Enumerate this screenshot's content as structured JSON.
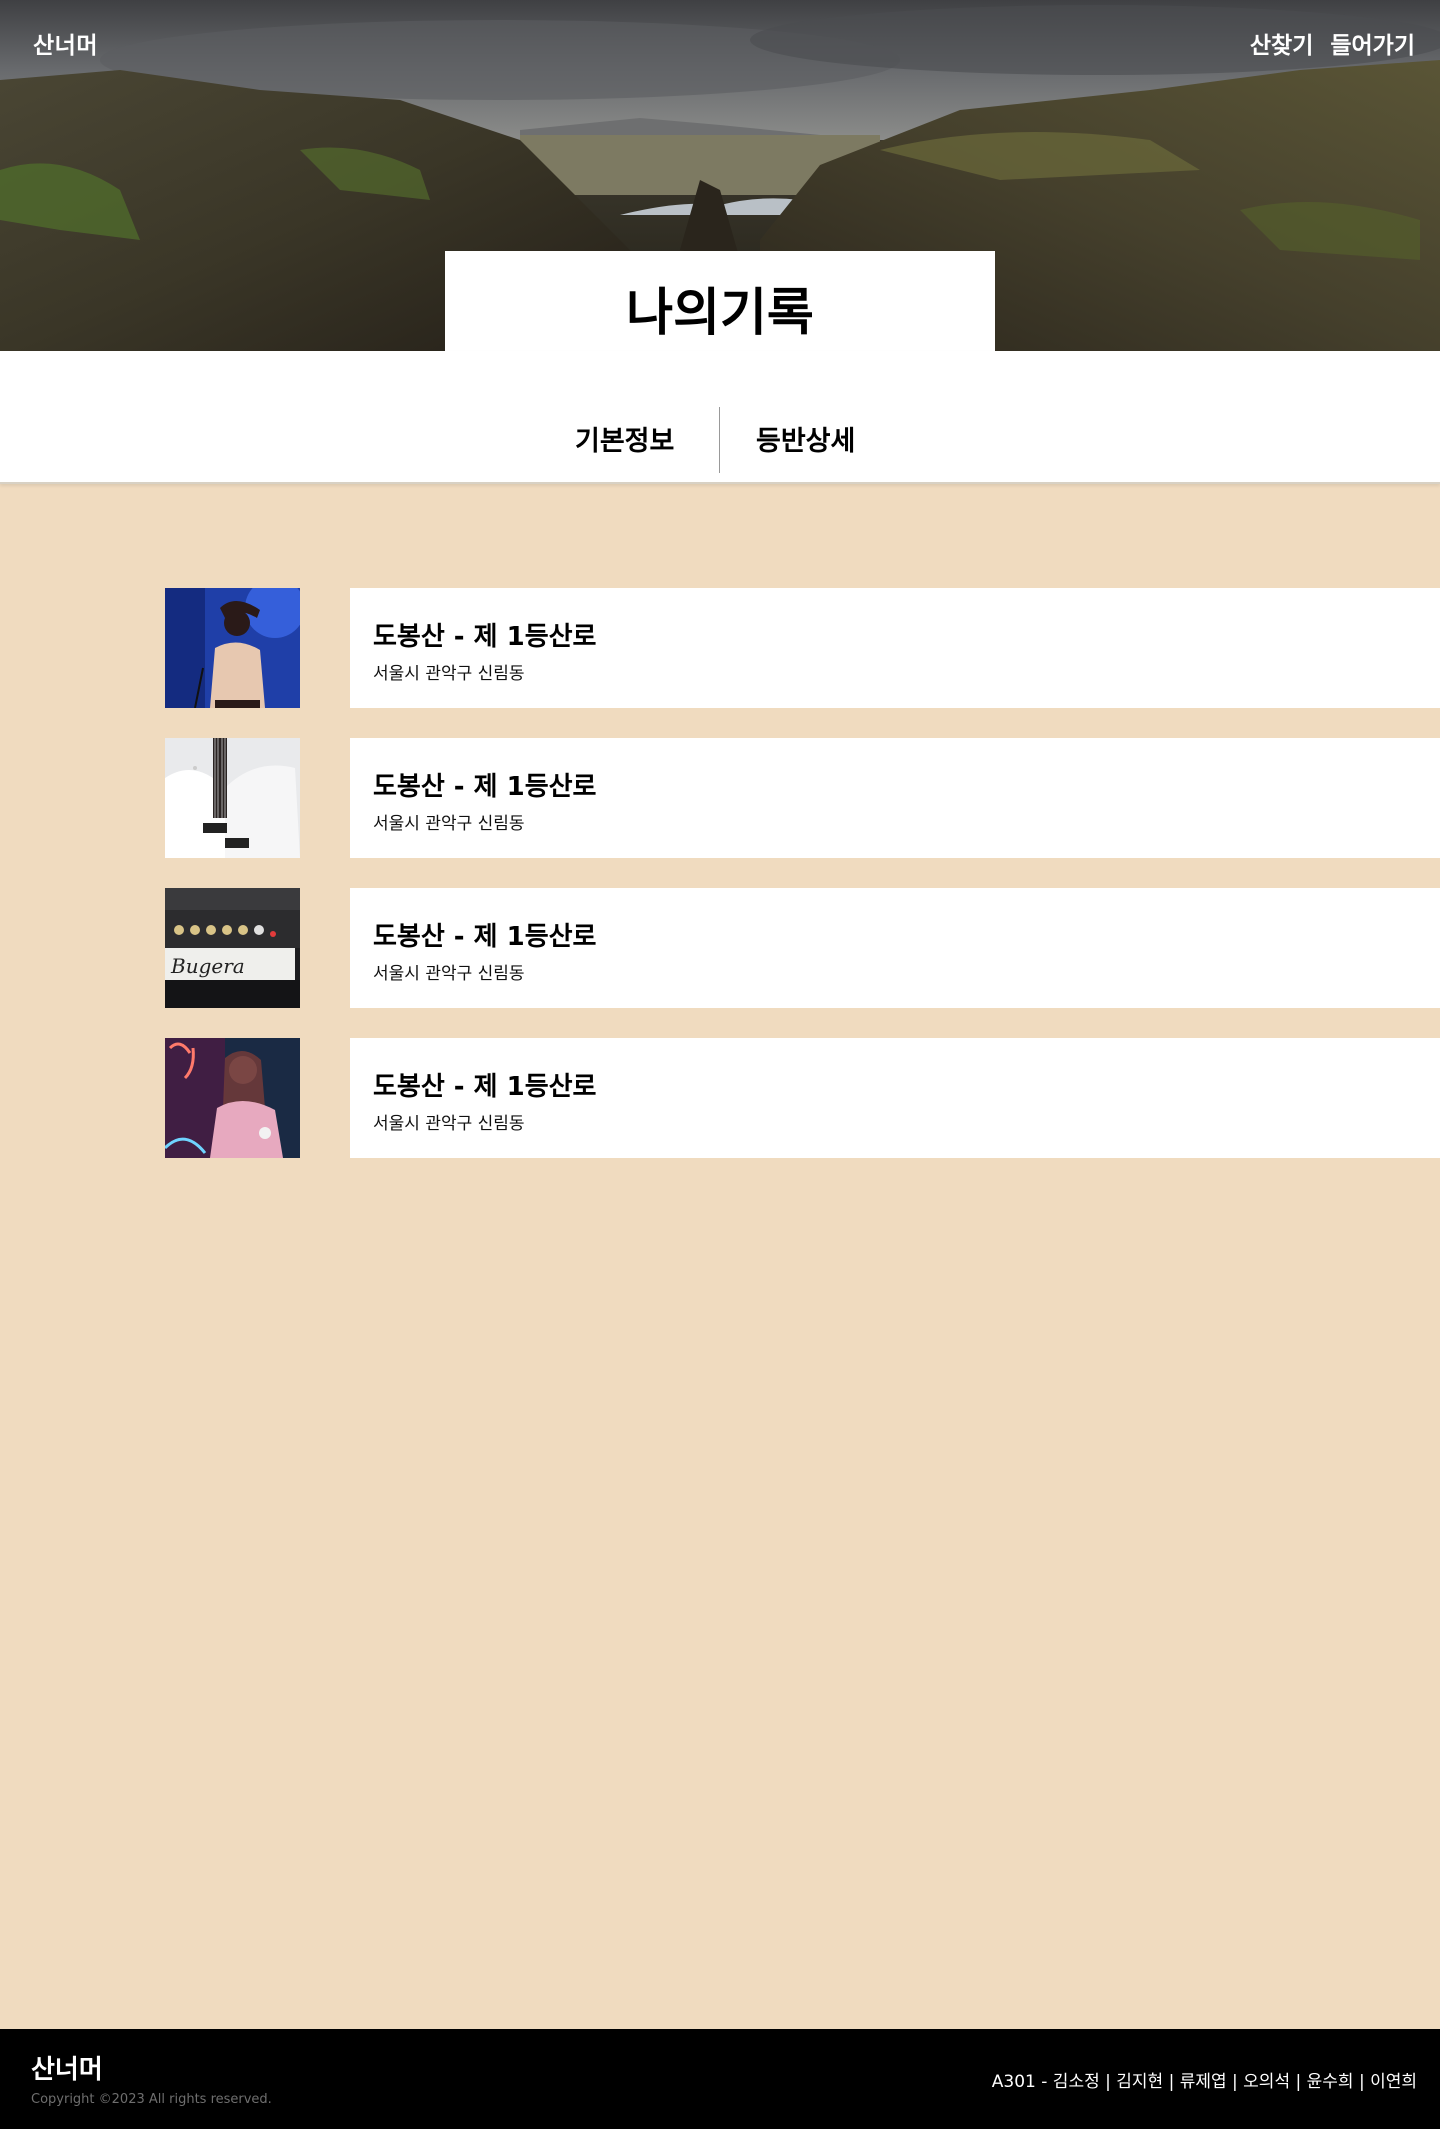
{
  "header": {
    "logo": "산너머",
    "nav": [
      "산찾기",
      "들어가기"
    ]
  },
  "page_title": "나의기록",
  "tabs": [
    "기본정보",
    "등반상세"
  ],
  "records": [
    {
      "title": "도봉산 - 제 1등산로",
      "location": "서울시 관악구 신림동",
      "thumbnail": "singer-on-stage"
    },
    {
      "title": "도봉산 - 제 1등산로",
      "location": "서울시 관악구 신림동",
      "thumbnail": "white-bass-guitar"
    },
    {
      "title": "도봉산 - 제 1등산로",
      "location": "서울시 관악구 신림동",
      "thumbnail": "guitar-amplifier"
    },
    {
      "title": "도봉산 - 제 1등산로",
      "location": "서울시 관악구 신림동",
      "thumbnail": "woman-neon-sign"
    }
  ],
  "footer": {
    "logo": "산너머",
    "copyright": "Copyright ©2023 All rights reserved.",
    "credits": "A301 - 김소정 | 김지현 | 류제엽 | 오의석 | 윤수희 | 이연희"
  },
  "colors": {
    "background": "#f0dbbf",
    "card": "#ffffff",
    "footer": "#000000"
  }
}
